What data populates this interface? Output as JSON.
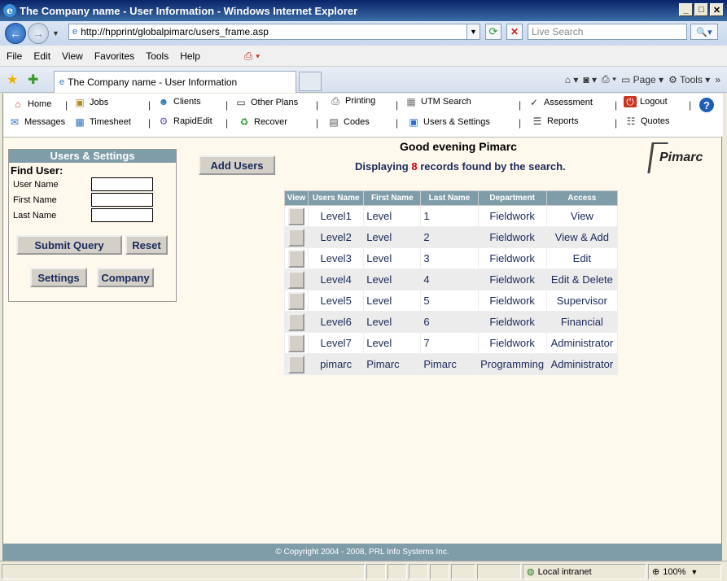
{
  "window": {
    "title": "The Company name - User Information - Windows Internet Explorer"
  },
  "address": {
    "url": "http://hpprint/globalpimarc/users_frame.asp",
    "search_placeholder": "Live Search"
  },
  "menu": [
    "File",
    "Edit",
    "View",
    "Favorites",
    "Tools",
    "Help"
  ],
  "tab": {
    "label": "The Company name - User Information"
  },
  "commandbar": {
    "page": "Page",
    "tools": "Tools"
  },
  "appnav": {
    "home": "Home",
    "jobs": "Jobs",
    "clients": "Clients",
    "other_plans": "Other Plans",
    "printing": "Printing",
    "utm_search": "UTM Search",
    "assessment": "Assessment",
    "logout": "Logout",
    "messages": "Messages",
    "timesheet": "Timesheet",
    "rapidedit": "RapidEdit",
    "recover": "Recover",
    "codes": "Codes",
    "users_settings": "Users & Settings",
    "reports": "Reports",
    "quotes": "Quotes"
  },
  "left_panel": {
    "title": "Users & Settings",
    "find_user": "Find User:",
    "user_name_label": "User Name",
    "first_name_label": "First Name",
    "last_name_label": "Last Name",
    "submit": "Submit Query",
    "reset": "Reset",
    "settings": "Settings",
    "company": "Company"
  },
  "main": {
    "add_users": "Add Users",
    "greeting": "Good evening Pimarc",
    "displaying_prefix": "Displaying",
    "record_count": "8",
    "displaying_suffix": "records found by the search.",
    "logo_text": "Pimarc"
  },
  "table": {
    "headers": [
      "View",
      "Users Name",
      "First Name",
      "Last Name",
      "Department",
      "Access"
    ],
    "rows": [
      {
        "users_name": "Level1",
        "first_name": "Level",
        "last_name": "1",
        "department": "Fieldwork",
        "access": "View"
      },
      {
        "users_name": "Level2",
        "first_name": "Level",
        "last_name": "2",
        "department": "Fieldwork",
        "access": "View & Add"
      },
      {
        "users_name": "Level3",
        "first_name": "Level",
        "last_name": "3",
        "department": "Fieldwork",
        "access": "Edit"
      },
      {
        "users_name": "Level4",
        "first_name": "Level",
        "last_name": "4",
        "department": "Fieldwork",
        "access": "Edit & Delete"
      },
      {
        "users_name": "Level5",
        "first_name": "Level",
        "last_name": "5",
        "department": "Fieldwork",
        "access": "Supervisor"
      },
      {
        "users_name": "Level6",
        "first_name": "Level",
        "last_name": "6",
        "department": "Fieldwork",
        "access": "Financial"
      },
      {
        "users_name": "Level7",
        "first_name": "Level",
        "last_name": "7",
        "department": "Fieldwork",
        "access": "Administrator"
      },
      {
        "users_name": "pimarc",
        "first_name": "Pimarc",
        "last_name": "Pimarc",
        "department": "Programming",
        "access": "Administrator"
      }
    ]
  },
  "footer": {
    "copyright": "© Copyright 2004 - 2008, PRL Info Systems Inc."
  },
  "statusbar": {
    "zone": "Local intranet",
    "zoom": "100%"
  }
}
